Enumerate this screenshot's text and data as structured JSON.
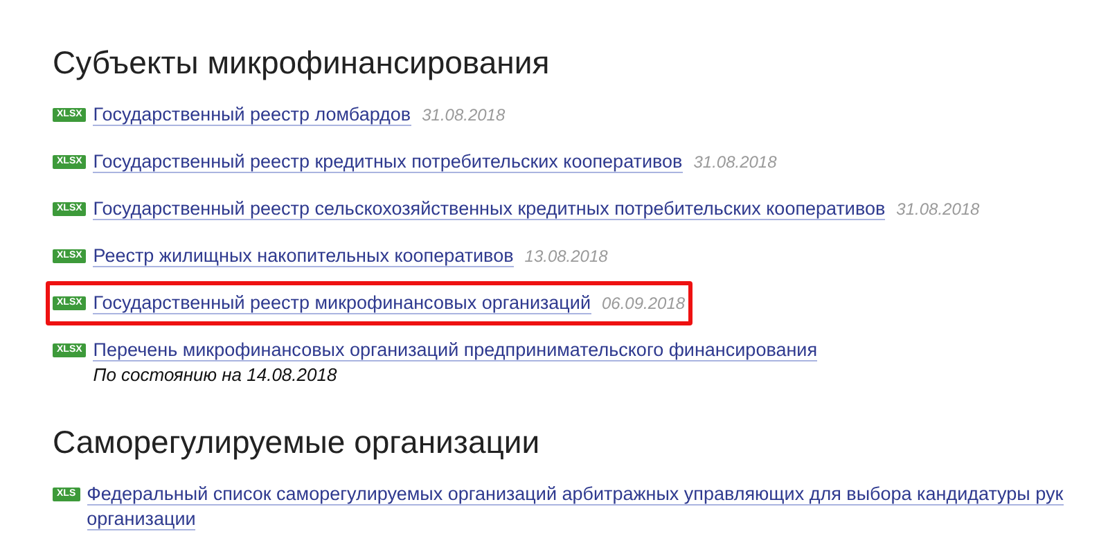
{
  "sections": [
    {
      "title": "Субъекты микрофинансирования",
      "items": [
        {
          "badge": "XLSX",
          "lines": [
            "Государственный реестр ломбардов"
          ],
          "date": "31.08.2018",
          "highlighted": false
        },
        {
          "badge": "XLSX",
          "lines": [
            "Государственный реестр кредитных потребительских кооперативов"
          ],
          "date": "31.08.2018",
          "highlighted": false
        },
        {
          "badge": "XLSX",
          "lines": [
            "Государственный реестр сельскохозяйственных кредитных потребительских кооперативов"
          ],
          "date": "31.08.2018",
          "highlighted": false
        },
        {
          "badge": "XLSX",
          "lines": [
            "Реестр жилищных накопительных кооперативов"
          ],
          "date": "13.08.2018",
          "highlighted": false
        },
        {
          "badge": "XLSX",
          "lines": [
            "Государственный реестр микрофинансовых организаций"
          ],
          "date": "06.09.2018",
          "highlighted": true
        },
        {
          "badge": "XLSX",
          "lines": [
            "Перечень микрофинансовых организаций предпринимательского финансирования"
          ],
          "note": "По состоянию на 14.08.2018",
          "highlighted": false
        }
      ]
    },
    {
      "title": "Саморегулируемые организации",
      "items": [
        {
          "badge": "XLS",
          "lines": [
            "Федеральный список саморегулируемых организаций арбитражных управляющих для выбора кандидатуры рук",
            "организации"
          ],
          "highlighted": false
        }
      ]
    }
  ]
}
